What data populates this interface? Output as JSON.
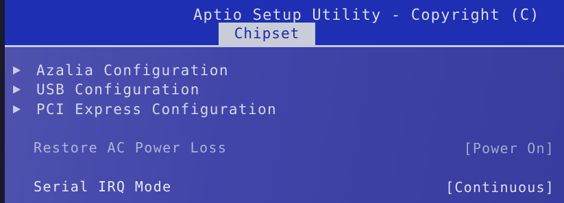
{
  "header": {
    "title": "Aptio Setup Utility - Copyright (C)",
    "active_tab": "Chipset"
  },
  "menu_items": [
    {
      "label": "Azalia Configuration",
      "icon": "submenu-arrow-icon"
    },
    {
      "label": "USB Configuration",
      "icon": "submenu-arrow-icon"
    },
    {
      "label": "PCI Express Configuration",
      "icon": "submenu-arrow-icon"
    }
  ],
  "settings": [
    {
      "label": "Restore AC Power Loss",
      "value": "[Power On]",
      "state": "disabled"
    },
    {
      "label": "Serial IRQ Mode",
      "value": "[Continuous]",
      "state": "enabled"
    }
  ],
  "colors": {
    "background": "#3c3ea6",
    "header": "#1e2fb4",
    "tab": "#c9cdd8",
    "text": "#d2d6ee"
  }
}
